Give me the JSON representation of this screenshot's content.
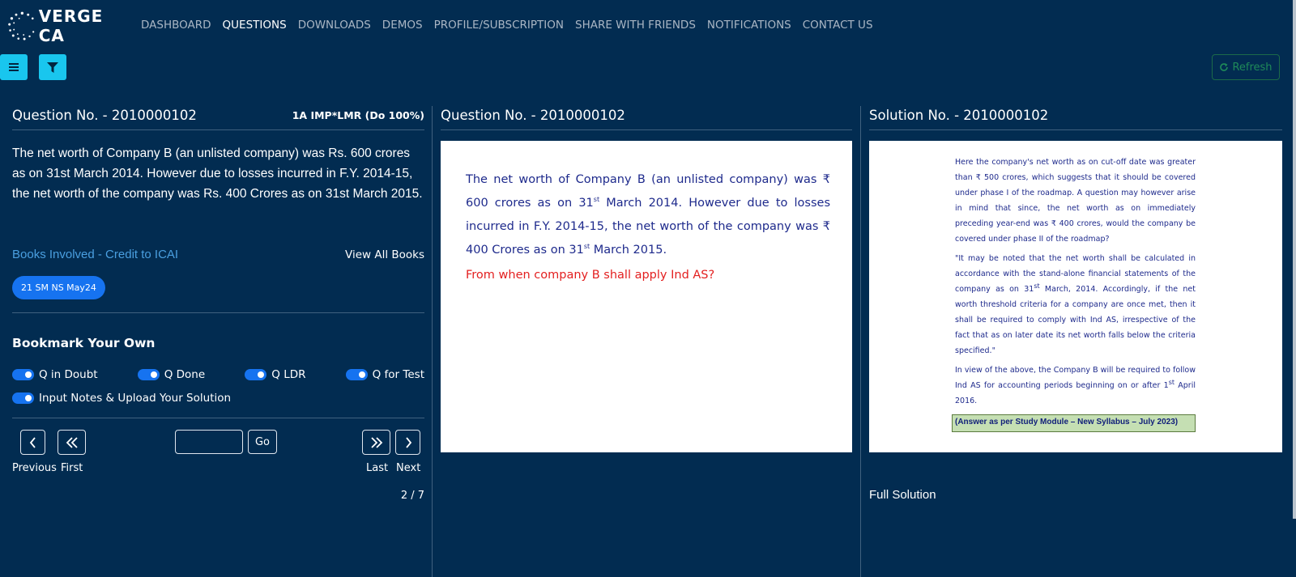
{
  "brand": {
    "name": "VERGE CA"
  },
  "nav": [
    {
      "label": "DASHBOARD",
      "active": false
    },
    {
      "label": "QUESTIONS",
      "active": true
    },
    {
      "label": "DOWNLOADS",
      "active": false
    },
    {
      "label": "DEMOS",
      "active": false
    },
    {
      "label": "PROFILE/SUBSCRIPTION",
      "active": false
    },
    {
      "label": "SHARE WITH FRIENDS",
      "active": false
    },
    {
      "label": "NOTIFICATIONS",
      "active": false
    },
    {
      "label": "CONTACT US",
      "active": false
    }
  ],
  "toolbar": {
    "refresh_label": "Refresh"
  },
  "left": {
    "title": "Question No. - 2010000102",
    "tag": "1A IMP*LMR (Do 100%)",
    "question_text": "The net worth of Company B (an unlisted company) was Rs. 600 crores as on 31st March 2014. However due to losses incurred in F.Y. 2014-15, the net worth of the company was Rs. 400 Crores as on 31st March 2015.",
    "books_label": "Books Involved - Credit to ICAI",
    "view_all_books": "View All Books",
    "book_chip": "21 SM NS May24",
    "bookmark_title": "Bookmark Your Own",
    "toggles": [
      {
        "label": "Q in Doubt",
        "on": true
      },
      {
        "label": "Q Done",
        "on": true
      },
      {
        "label": "Q LDR",
        "on": true
      },
      {
        "label": "Q for Test",
        "on": true
      },
      {
        "label": "Input Notes & Upload Your Solution",
        "on": true
      }
    ],
    "pager": {
      "previous": "Previous",
      "first": "First",
      "go": "Go",
      "last": "Last",
      "next": "Next",
      "count": "2 / 7"
    }
  },
  "middle": {
    "title": "Question No. - 2010000102",
    "image_text_a": "The net worth of Company B (an unlisted company) was ₹ 600 crores as on 31",
    "image_text_b": " March 2014. However due to losses incurred in F.Y. 2014-15, the net worth of the company was ₹ 400 Crores as on 31",
    "image_text_c": " March 2015.",
    "sup_st": "st",
    "image_question": "From when company B shall apply Ind AS?"
  },
  "right": {
    "title": "Solution No. - 2010000102",
    "para1": "Here the company's net worth as on cut-off date was greater than ₹ 500 crores, which suggests that it should be covered under phase I of the roadmap. A question may however arise in mind that since, the net worth as on immediately preceding year-end was ₹ 400 crores, would the company be covered under phase II of the roadmap?",
    "para2_a": "\"It may be noted that the net worth shall be calculated in accordance with the stand-alone financial statements of the company as on 31",
    "para2_b": " March, 2014. Accordingly, if the net worth threshold criteria for a company are once met, then it shall be required to comply with Ind AS, irrespective of the fact that as on later date its net worth falls below the criteria specified.\"",
    "para3_a": "In view of the above, the Company B will be required to follow Ind AS for accounting periods beginning on or after 1",
    "para3_b": " April 2016.",
    "sup_st": "st",
    "answer_box": "(Answer as per Study Module – New Syllabus – July 2023)",
    "full_solution": "Full Solution"
  }
}
